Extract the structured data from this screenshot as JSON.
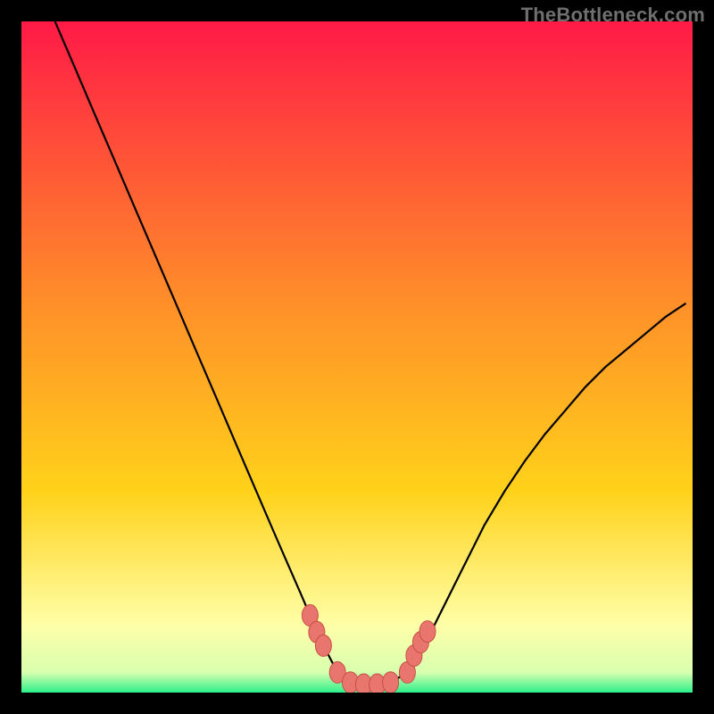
{
  "watermark": "TheBottleneck.com",
  "colors": {
    "curve": "#000000",
    "marker_fill": "#e9766e",
    "marker_stroke": "#c94f46",
    "grad_top": "#ff1a46",
    "grad_mid1": "#ff6a2a",
    "grad_mid2": "#ffd21a",
    "grad_pale": "#ffffa8",
    "grad_green": "#2cf08b"
  },
  "chart_data": {
    "type": "line",
    "title": "",
    "xlabel": "",
    "ylabel": "",
    "xlim": [
      0,
      100
    ],
    "ylim": [
      0,
      100
    ],
    "legend": false,
    "grid": false,
    "x": [
      5,
      8,
      11,
      14,
      17,
      20,
      23,
      26,
      29,
      32,
      35,
      38,
      41.5,
      43,
      45,
      47.1,
      49,
      51,
      53,
      55,
      57.5,
      60,
      63,
      66,
      69,
      72,
      75,
      78,
      81,
      84,
      87,
      90,
      93,
      96,
      99
    ],
    "values": [
      100,
      93,
      86,
      79,
      72,
      65,
      58,
      51,
      44,
      37,
      30,
      23,
      15,
      11.5,
      7,
      3,
      1.5,
      1.2,
      1.2,
      1.5,
      3,
      7,
      13,
      19,
      25,
      30,
      34.5,
      38.5,
      42,
      45.5,
      48.5,
      51,
      53.5,
      56,
      58
    ],
    "flat_region_x": [
      48,
      58
    ],
    "markers": [
      {
        "x": 43.0,
        "y": 11.5
      },
      {
        "x": 44.0,
        "y": 9.0
      },
      {
        "x": 45.0,
        "y": 7.0
      },
      {
        "x": 47.1,
        "y": 3.0
      },
      {
        "x": 49.0,
        "y": 1.5
      },
      {
        "x": 51.0,
        "y": 1.2
      },
      {
        "x": 53.0,
        "y": 1.2
      },
      {
        "x": 55.0,
        "y": 1.5
      },
      {
        "x": 57.5,
        "y": 3.0
      },
      {
        "x": 58.5,
        "y": 5.5
      },
      {
        "x": 59.5,
        "y": 7.5
      },
      {
        "x": 60.5,
        "y": 9.1
      }
    ]
  }
}
